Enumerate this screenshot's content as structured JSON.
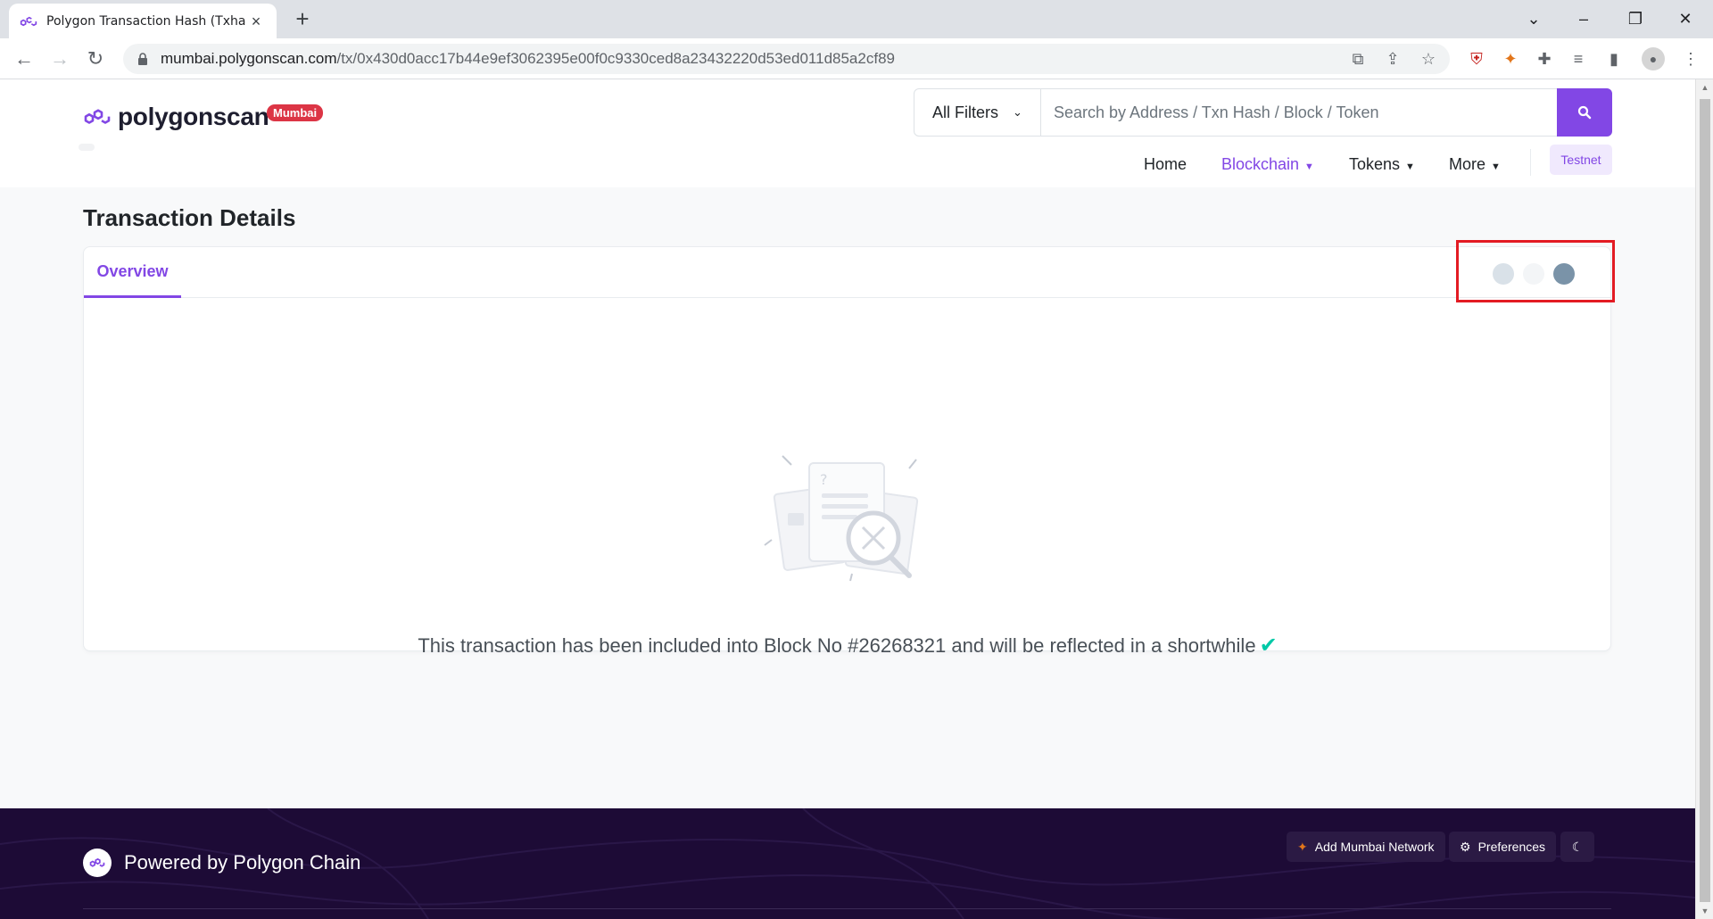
{
  "browser": {
    "tab_title": "Polygon Transaction Hash (Txhas",
    "url_host": "mumbai.polygonscan.com",
    "url_path": "/tx/0x430d0acc17b44e9ef3062395e00f0c9330ced8a23432220d53ed011d85a2cf89"
  },
  "site": {
    "logo_text": "polygonscan",
    "network_badge": "Mumbai"
  },
  "search": {
    "filter_label": "All Filters",
    "placeholder": "Search by Address / Txn Hash / Block / Token"
  },
  "nav": {
    "home": "Home",
    "blockchain": "Blockchain",
    "tokens": "Tokens",
    "more": "More",
    "testnet": "Testnet"
  },
  "page": {
    "title": "Transaction Details",
    "tab_overview": "Overview",
    "message": "This transaction has been included into Block No #26268321 and will be reflected in a shortwhile"
  },
  "footer": {
    "powered_by": "Powered by Polygon Chain",
    "add_network": "Add Mumbai Network",
    "preferences": "Preferences"
  },
  "colors": {
    "brand": "#8247e5",
    "badge": "#dc3545",
    "highlight_box": "#e31b23",
    "success": "#00c9a7",
    "footer_bg": "#1d0b36"
  }
}
